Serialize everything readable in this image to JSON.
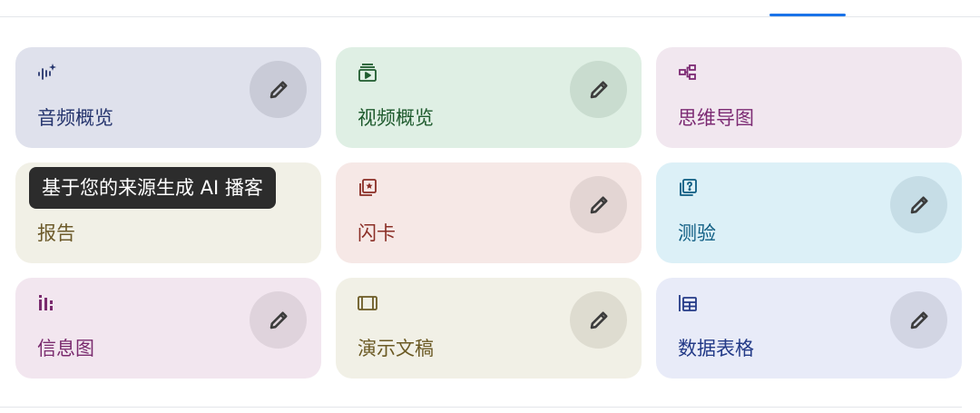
{
  "tooltip": {
    "text": "基于您的来源生成 AI 播客"
  },
  "cards": [
    {
      "label": "音频概览",
      "icon": "audio-sparkle-icon",
      "bg": "#dfe1ec",
      "color": "#26356e",
      "btn_bg": "#c9cbd7",
      "has_edit": true
    },
    {
      "label": "视频概览",
      "icon": "video-play-icon",
      "bg": "#dfefe4",
      "color": "#1f5b2e",
      "btn_bg": "#c9dccf",
      "has_edit": true
    },
    {
      "label": "思维导图",
      "icon": "mind-map-icon",
      "bg": "#f1e7ef",
      "color": "#7c2a73",
      "btn_bg": "#dfd3dc",
      "has_edit": false
    },
    {
      "label": "报告",
      "icon": "report-icon",
      "bg": "#f1f0e6",
      "color": "#6d5b2b",
      "btn_bg": "#dedcd0",
      "has_edit": false
    },
    {
      "label": "闪卡",
      "icon": "flashcard-icon",
      "bg": "#f6e8e6",
      "color": "#8a2e26",
      "btn_bg": "#e3d5d3",
      "has_edit": true
    },
    {
      "label": "测验",
      "icon": "quiz-icon",
      "bg": "#dcf0f7",
      "color": "#0d5c82",
      "btn_bg": "#c6dde6",
      "has_edit": true
    },
    {
      "label": "信息图",
      "icon": "infographic-icon",
      "bg": "#f2e6ef",
      "color": "#7a2b6e",
      "btn_bg": "#dfd3dc",
      "has_edit": true
    },
    {
      "label": "演示文稿",
      "icon": "slides-icon",
      "bg": "#f1f0e6",
      "color": "#6b5a24",
      "btn_bg": "#dedcd0",
      "has_edit": true
    },
    {
      "label": "数据表格",
      "icon": "data-table-icon",
      "bg": "#e8ebf8",
      "color": "#233a87",
      "btn_bg": "#d2d5e3",
      "has_edit": true
    }
  ]
}
